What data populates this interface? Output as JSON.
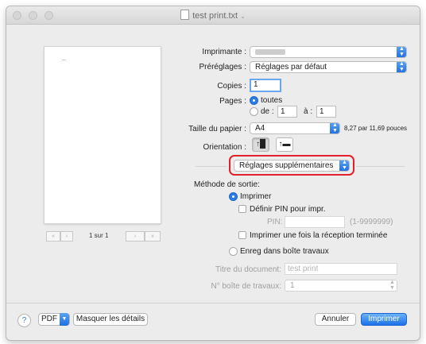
{
  "window": {
    "title": "test print.txt"
  },
  "preview": {
    "page_indicator": "1 sur 1"
  },
  "printer": {
    "label": "Imprimante :"
  },
  "presets": {
    "label": "Préréglages :",
    "value": "Réglages par défaut"
  },
  "copies": {
    "label": "Copies :",
    "value": "1"
  },
  "pages": {
    "label": "Pages :",
    "all_label": "toutes",
    "from_label": "de :",
    "from_value": "1",
    "to_label": "à :",
    "to_value": "1"
  },
  "paper": {
    "label": "Taille du papier :",
    "value": "A4",
    "dimensions": "8,27 par 11,69 pouces"
  },
  "orientation": {
    "label": "Orientation :"
  },
  "panel_select": {
    "value": "Réglages supplémentaires"
  },
  "output_method": {
    "label": "Méthode de sortie:",
    "print_label": "Imprimer",
    "pin_label": "Définir PIN pour impr.",
    "pin_field_label": "PIN:",
    "pin_range": "(1-9999999)",
    "print_once_label": "Imprimer une fois la réception terminée",
    "store_label": "Enreg dans boîte travaux"
  },
  "document_title": {
    "label": "Titre du document:",
    "value": "test print"
  },
  "box_number": {
    "label": "N° boîte de travaux:",
    "value": "1"
  },
  "footer": {
    "help": "?",
    "pdf_label": "PDF",
    "hide_details_label": "Masquer les détails",
    "cancel_label": "Annuler",
    "print_label": "Imprimer"
  },
  "colors": {
    "accent": "#1b72e8",
    "highlight": "#e0202a"
  }
}
